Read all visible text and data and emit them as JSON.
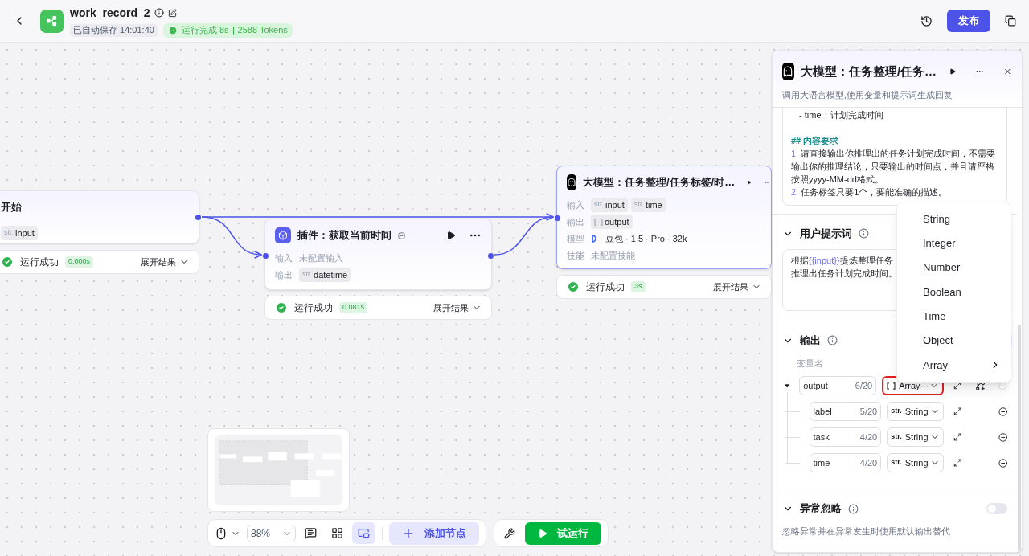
{
  "header": {
    "title": "work_record_2",
    "autosave": "已自动保存 14:01:40",
    "run_status": "运行完成 8s",
    "tokens": "2588 Tokens",
    "publish": "发布"
  },
  "canvas": {
    "nodes": [
      {
        "kind": "start",
        "title": "开始",
        "selected": false,
        "rows": [
          {
            "vars": [
              {
                "kind": "string",
                "type": "str.",
                "name": "input"
              }
            ]
          }
        ],
        "result": {
          "status": "运行成功",
          "time": "0.000s",
          "expand": "展开结果"
        }
      },
      {
        "kind": "plugin",
        "title": "插件：获取当前时间",
        "selected": false,
        "rows": [
          {
            "label": "输入",
            "placeholder": "未配置输入"
          },
          {
            "label": "输出",
            "vars": [
              {
                "kind": "string",
                "type": "str.",
                "name": "datetime"
              }
            ]
          }
        ],
        "result": {
          "status": "运行成功",
          "time": "0.081s",
          "expand": "展开结果"
        }
      },
      {
        "kind": "llm",
        "title": "大模型：任务整理/任务标签/时…",
        "selected": true,
        "rows": [
          {
            "label": "输入",
            "vars": [
              {
                "kind": "string",
                "type": "str.",
                "name": "input"
              },
              {
                "kind": "string",
                "type": "str.",
                "name": "time"
              }
            ]
          },
          {
            "label": "输出",
            "vars": [
              {
                "kind": "array",
                "name": "output"
              }
            ]
          },
          {
            "label": "模型",
            "model": "豆包 · 1.5 · Pro · 32k"
          },
          {
            "label": "技能",
            "placeholder": "未配置技能"
          }
        ],
        "result": {
          "status": "运行成功",
          "time": "3s",
          "expand": "展开结果"
        }
      }
    ]
  },
  "toolbar": {
    "zoom": "88%",
    "tools": [
      {
        "kind": "comment",
        "selected": false
      },
      {
        "kind": "layout",
        "selected": false
      },
      {
        "kind": "minimap",
        "selected": true
      }
    ],
    "add_node": "添加节点",
    "test_run": "试运行"
  },
  "panel": {
    "title": "大模型：任务整理/任务…",
    "description": "调用大语言模型,使用变量和提示词生成回复",
    "system_prompt": [
      {
        "kind": "bullet",
        "text": "- time：计划完成时间"
      },
      {
        "kind": "heading",
        "text": "## 内容要求"
      },
      {
        "kind": "numbered",
        "number": "1.",
        "text": "请直接输出你推理出的任务计划完成时间，不需要输出你的推理结论，只要输出的时间点，并且请严格按照yyyy-MM-dd格式。"
      },
      {
        "kind": "numbered",
        "number": "2.",
        "text": "任务标签只要1个，要能准确的描述。"
      }
    ],
    "user_prompt": {
      "title": "用户提示词",
      "lines": [
        [
          {
            "text": "根据"
          },
          {
            "kind": "variable",
            "text": "{{input}}"
          },
          {
            "text": "提炼整理任务"
          }
        ],
        [
          {
            "text": "推理出任务计划完成时间。"
          }
        ]
      ]
    },
    "output": {
      "title": "输出",
      "column": "变量名",
      "vars": [
        {
          "name": "output",
          "count": "6/20",
          "kind": "array",
          "type": "Array···",
          "highlighted": true,
          "expanded": true,
          "children": [
            {
              "name": "label",
              "count": "5/20",
              "kind": "string",
              "prefix": "str.",
              "type": "String",
              "highlighted": false
            },
            {
              "name": "task",
              "count": "4/20",
              "kind": "string",
              "prefix": "str.",
              "type": "String",
              "highlighted": false
            },
            {
              "name": "time",
              "count": "4/20",
              "kind": "string",
              "prefix": "str.",
              "type": "String",
              "highlighted": false
            }
          ]
        }
      ]
    },
    "exception": {
      "title": "异常忽略",
      "on": false,
      "description": "忽略异常并在异常发生时使用默认输出替代"
    },
    "type_menu": [
      {
        "label": "String",
        "has_submenu": false
      },
      {
        "label": "Integer",
        "has_submenu": false
      },
      {
        "label": "Number",
        "has_submenu": false
      },
      {
        "label": "Boolean",
        "has_submenu": false
      },
      {
        "label": "Time",
        "has_submenu": false
      },
      {
        "label": "Object",
        "has_submenu": false
      },
      {
        "label": "Array",
        "has_submenu": true
      }
    ]
  }
}
